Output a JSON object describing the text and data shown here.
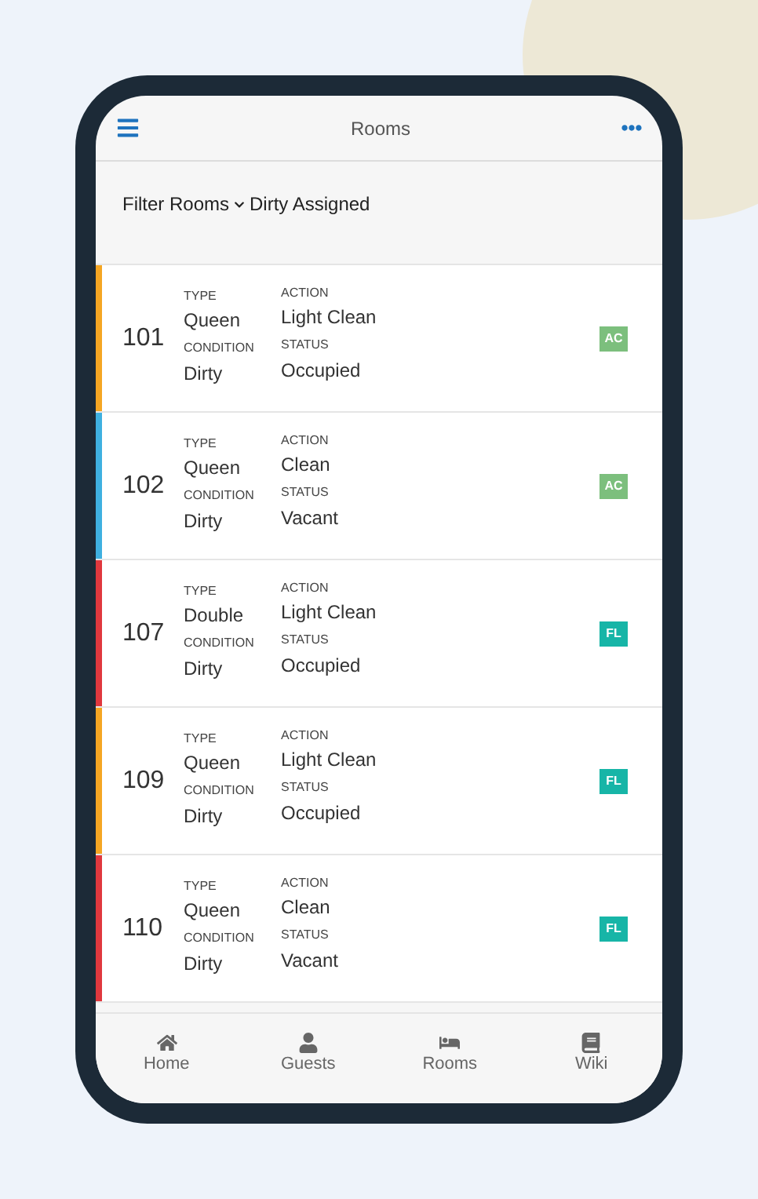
{
  "header": {
    "title": "Rooms"
  },
  "filter": {
    "label": "Filter Rooms",
    "value": "Dirty Assigned"
  },
  "rooms": [
    {
      "number": "101",
      "type_label": "TYPE",
      "type": "Queen",
      "condition_label": "CONDITION",
      "condition": "Dirty",
      "action_label": "ACTION",
      "action": "Light Clean",
      "status_label": "STATUS",
      "status": "Occupied",
      "color": "#f5a623",
      "badge": {
        "text": "AC",
        "color": "#7cbf7d"
      }
    },
    {
      "number": "102",
      "type_label": "TYPE",
      "type": "Queen",
      "condition_label": "CONDITION",
      "condition": "Dirty",
      "action_label": "ACTION",
      "action": "Clean",
      "status_label": "STATUS",
      "status": "Vacant",
      "color": "#3fb0e0",
      "badge": {
        "text": "AC",
        "color": "#7cbf7d"
      }
    },
    {
      "number": "107",
      "type_label": "TYPE",
      "type": "Double",
      "condition_label": "CONDITION",
      "condition": "Dirty",
      "action_label": "ACTION",
      "action": "Light Clean",
      "status_label": "STATUS",
      "status": "Occupied",
      "color": "#e0383e",
      "badge": {
        "text": "FL",
        "color": "#17b5a7"
      }
    },
    {
      "number": "109",
      "type_label": "TYPE",
      "type": "Queen",
      "condition_label": "CONDITION",
      "condition": "Dirty",
      "action_label": "ACTION",
      "action": "Light Clean",
      "status_label": "STATUS",
      "status": "Occupied",
      "color": "#f5a623",
      "badge": {
        "text": "FL",
        "color": "#17b5a7"
      }
    },
    {
      "number": "110",
      "type_label": "TYPE",
      "type": "Queen",
      "condition_label": "CONDITION",
      "condition": "Dirty",
      "action_label": "ACTION",
      "action": "Clean",
      "status_label": "STATUS",
      "status": "Vacant",
      "color": "#e0383e",
      "badge": {
        "text": "FL",
        "color": "#17b5a7"
      }
    }
  ],
  "tabs": [
    {
      "label": "Home",
      "kind": "home"
    },
    {
      "label": "Guests",
      "kind": "guests"
    },
    {
      "label": "Rooms",
      "kind": "rooms"
    },
    {
      "label": "Wiki",
      "kind": "wiki"
    }
  ]
}
